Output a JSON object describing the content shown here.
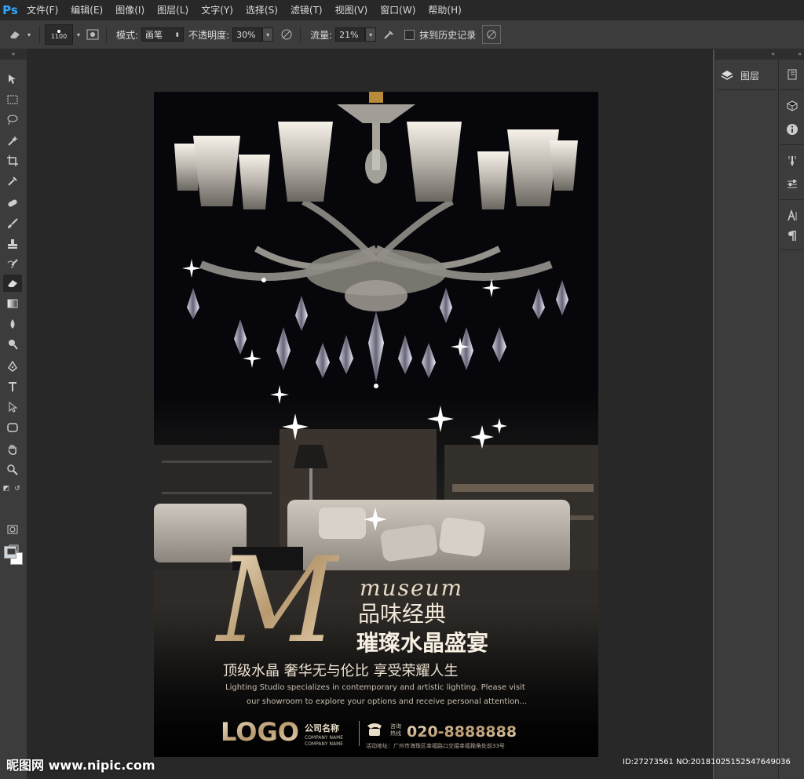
{
  "app": {
    "logo": "Ps"
  },
  "menu": [
    "文件(F)",
    "编辑(E)",
    "图像(I)",
    "图层(L)",
    "文字(Y)",
    "选择(S)",
    "滤镜(T)",
    "视图(V)",
    "窗口(W)",
    "帮助(H)"
  ],
  "options": {
    "brush_size": "1100",
    "mode_label": "模式:",
    "mode_value": "画笔",
    "opacity_label": "不透明度:",
    "opacity_value": "30%",
    "flow_label": "流量:",
    "flow_value": "21%",
    "erase_history_label": "抹到历史记录"
  },
  "layers_panel": {
    "label": "图层"
  },
  "poster": {
    "big_letter": "M",
    "museum": "museum",
    "line1": "品味经典",
    "line2": "璀璨水晶盛宴",
    "line3": "顶级水晶  奢华无与伦比  享受荣耀人生",
    "english1": "Lighting Studio specializes in contemporary and artistic lighting. Please visit",
    "english2": "our showroom to explore your options and receive personal attention...",
    "logo": "LOGO",
    "company_cn": "公司名称",
    "company_en1": "COMPANY NAME",
    "company_en2": "COMPANY NAME",
    "hotline_cn1": "咨询",
    "hotline_cn2": "热线",
    "phone": "020-8888888",
    "address": "活动地址：广州市海珠区幸福路口交接幸福挽角处前33号"
  },
  "watermark": {
    "left": "昵图网 www.nipic.com",
    "right": "ID:27273561 NO:20181025152547649036"
  },
  "colors": {
    "accent": "#31a8ff",
    "gold": "#e0cfb4"
  }
}
